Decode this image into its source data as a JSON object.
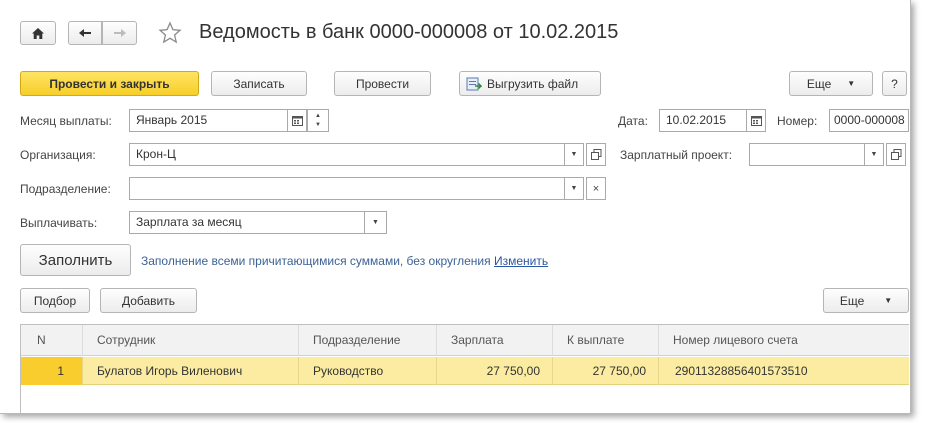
{
  "window": {
    "title": "Ведомость в банк 0000-000008 от 10.02.2015"
  },
  "toolbar": {
    "post_close_label": "Провести и закрыть",
    "save_label": "Записать",
    "post_label": "Провести",
    "export_label": "Выгрузить файл",
    "more_label": "Еще",
    "help_label": "?"
  },
  "form": {
    "month_label": "Месяц выплаты:",
    "month_value": "Январь 2015",
    "date_label": "Дата:",
    "date_value": "10.02.2015",
    "number_label": "Номер:",
    "number_value": "0000-000008",
    "org_label": "Организация:",
    "org_value": "Крон-Ц",
    "payroll_project_label": "Зарплатный проект:",
    "payroll_project_value": "",
    "department_label": "Подразделение:",
    "department_value": "",
    "pay_label": "Выплачивать:",
    "pay_value": "Зарплата за месяц"
  },
  "fill": {
    "button_label": "Заполнить",
    "info_text": "Заполнение всеми причитающимися суммами, без округления",
    "change_link": "Изменить"
  },
  "table_toolbar": {
    "select_label": "Подбор",
    "add_label": "Добавить",
    "more_label": "Еще"
  },
  "table": {
    "columns": [
      "N",
      "Сотрудник",
      "Подразделение",
      "Зарплата",
      "К выплате",
      "Номер лицевого счета"
    ],
    "rows": [
      [
        "1",
        "Булатов Игорь Виленович",
        "Руководство",
        "27 750,00",
        "27 750,00",
        "29011328856401573510"
      ]
    ]
  },
  "colors": {
    "primary_button": "#f7cf2a",
    "selected_row": "#fbeca1",
    "selected_cell": "#f9cd2e",
    "link": "#2a56a3"
  }
}
